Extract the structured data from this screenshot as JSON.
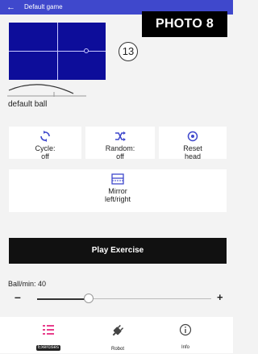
{
  "appbar": {
    "back_icon": "arrow-left-icon",
    "title": "Default game"
  },
  "overlay": {
    "photo_label": "PHOTO 8"
  },
  "table": {
    "count": "13"
  },
  "ball": {
    "label": "default ball"
  },
  "controls": {
    "cycle": {
      "label": "Cycle:",
      "value": "off",
      "icon": "cycle-icon"
    },
    "random": {
      "label": "Random:",
      "value": "off",
      "icon": "shuffle-icon"
    },
    "reset": {
      "label": "Reset",
      "value": "head",
      "icon": "target-icon"
    },
    "mirror": {
      "label": "Mirror",
      "value": "left/right",
      "icon": "mirror-icon"
    }
  },
  "play": {
    "label": "Play Exercise"
  },
  "speed": {
    "label": "Ball/min: 40",
    "minus": "–",
    "plus": "+",
    "value": 40
  },
  "nav": {
    "exercises": "Exercises",
    "robot": "Robot",
    "info": "Info"
  },
  "colors": {
    "appbar": "#3f48cc",
    "table": "#0d0d9a",
    "accent_pink": "#e83e8c"
  }
}
